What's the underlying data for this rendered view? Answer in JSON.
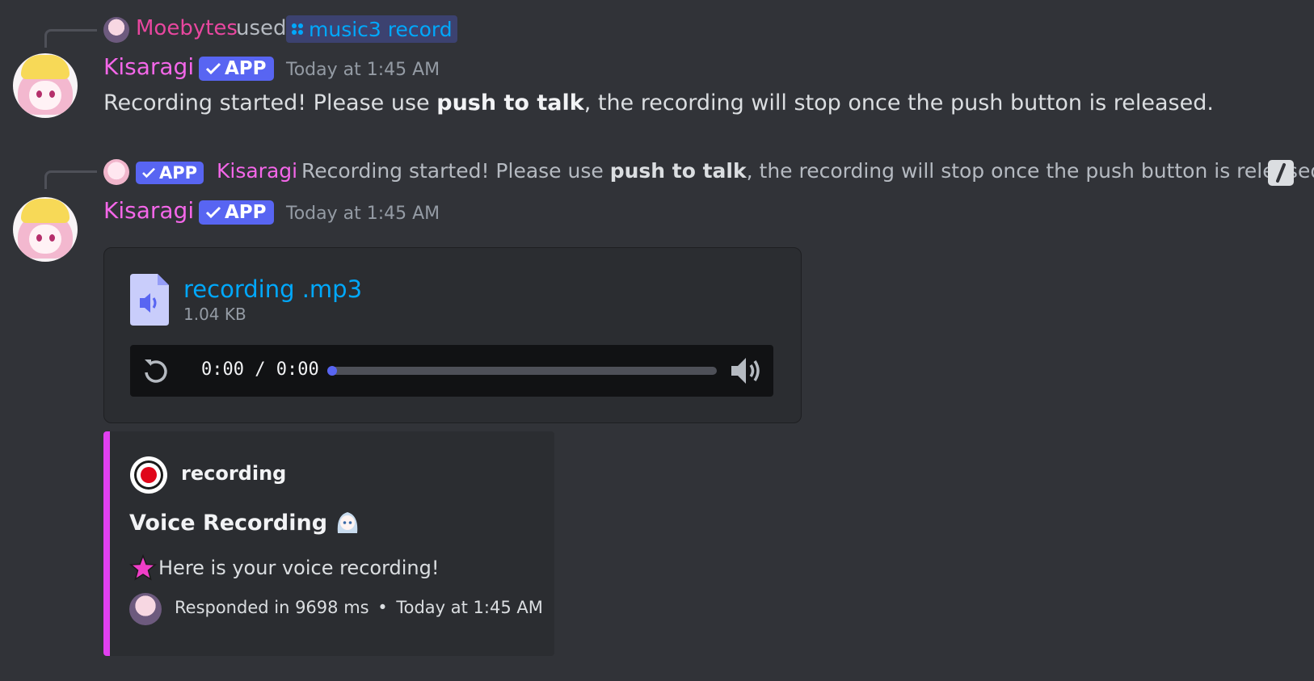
{
  "message1": {
    "reply": {
      "user": "Moebytes",
      "verb": "used",
      "command": "music3 record"
    },
    "author": "Kisaragi",
    "badge": "APP",
    "timestamp": "Today at 1:45 AM",
    "text_before": "Recording started! Please use ",
    "text_bold": "push to talk",
    "text_after": ", the recording will stop once the push button is released."
  },
  "message2": {
    "reply": {
      "badge": "APP",
      "author": "Kisaragi",
      "text_before": "Recording started! Please use ",
      "text_bold": "push to talk",
      "text_after": ", the recording will stop once the push button is released."
    },
    "author": "Kisaragi",
    "badge": "APP",
    "timestamp": "Today at 1:45 AM",
    "attachment": {
      "filename": "recording .mp3",
      "size": "1.04 KB",
      "time_display": "0:00 / 0:00",
      "progress": 0,
      "icons": [
        "audio-file-icon",
        "replay-icon",
        "volume-icon"
      ]
    },
    "embed": {
      "author": "recording",
      "title": "Voice Recording",
      "description": "Here is your voice recording!",
      "footer_text": "Responded in 9698 ms",
      "footer_separator": "•",
      "footer_time": "Today at 1:45 AM",
      "color": "#e140f0",
      "icons": [
        "record-icon",
        "anime-girl-emoji",
        "star-emoji",
        "avatar-icon"
      ]
    }
  },
  "colors": {
    "background": "#313338",
    "username": "#f467e9",
    "app_badge": "#5865f2",
    "link": "#00a8fc",
    "reply_user": "#e8479f"
  }
}
